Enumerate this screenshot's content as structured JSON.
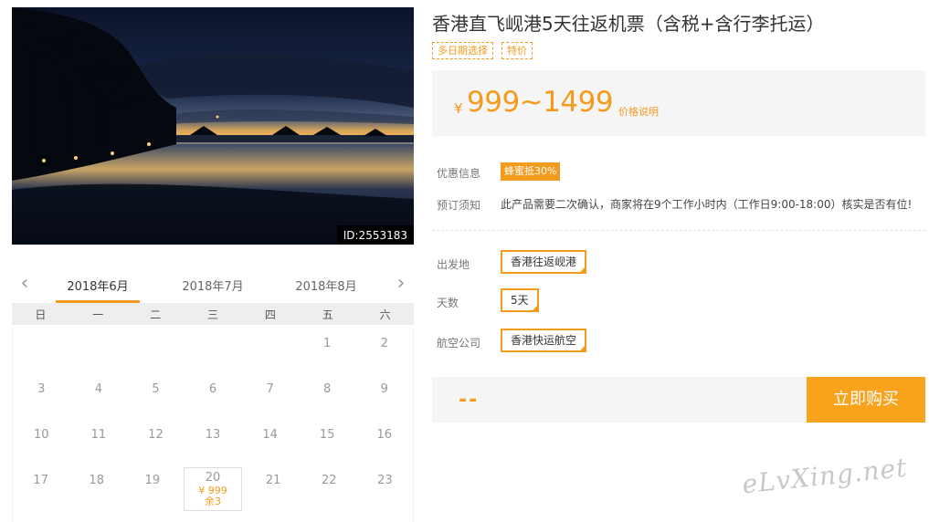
{
  "hero": {
    "image_id": "ID:2553183"
  },
  "calendar": {
    "months": [
      "2018年6月",
      "2018年7月",
      "2018年8月"
    ],
    "active_month_index": 0,
    "prev_icon": "chevron-left-icon",
    "next_icon": "chevron-right-icon",
    "weekdays": [
      "日",
      "一",
      "二",
      "三",
      "四",
      "五",
      "六"
    ],
    "weeks": [
      [
        "",
        "",
        "",
        "",
        "",
        "1",
        "2"
      ],
      [
        "3",
        "4",
        "5",
        "6",
        "7",
        "8",
        "9"
      ],
      [
        "10",
        "11",
        "12",
        "13",
        "14",
        "15",
        "16"
      ],
      [
        "17",
        "18",
        "19",
        "20",
        "21",
        "22",
        "23"
      ]
    ],
    "selected_day": {
      "day": "20",
      "price": "¥ 999",
      "remaining": "余3"
    }
  },
  "product": {
    "title": "香港直飞岘港5天往返机票（含税+含行李托运）",
    "tags": [
      "多日期选择",
      "特价"
    ],
    "price_currency": "¥",
    "price_range": "999~1499",
    "price_note": "价格说明",
    "promo_label": "优惠信息",
    "promo_badge": "蜂蜜抵30%",
    "notice_label": "预订须知",
    "notice_text": "此产品需要二次确认，商家将在9个工作小时内（工作日9:00-18:00）核实是否有位!",
    "departure_label": "出发地",
    "departure_value": "香港往返岘港",
    "days_label": "天数",
    "days_value": "5天",
    "airline_label": "航空公司",
    "airline_value": "香港快运航空",
    "total_placeholder": "--",
    "buy_label": "立即购买"
  },
  "watermark": "eLvXing.net",
  "colors": {
    "accent": "#f39b1d",
    "button": "#f9a21c",
    "panel": "#f5f5f5"
  }
}
